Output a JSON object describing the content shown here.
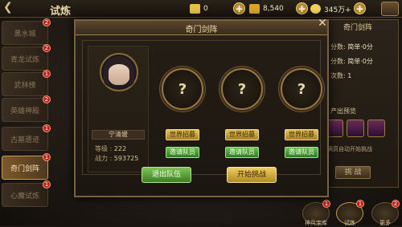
{
  "header": {
    "title": "试炼",
    "back_icon": "back-arrow-icon"
  },
  "resources": [
    {
      "name": "元宝",
      "value": "0",
      "color": "#e6c04a"
    },
    {
      "name": "金币",
      "value": "8,540",
      "color": "#d9a52a"
    },
    {
      "name": "体力",
      "value": "345万+",
      "color": "#f0d060"
    }
  ],
  "sidebar": {
    "items": [
      {
        "label": "黑水城",
        "badge": "2"
      },
      {
        "label": "青龙试炼",
        "badge": "2"
      },
      {
        "label": "武林榜",
        "badge": "1"
      },
      {
        "label": "英雄神殿",
        "badge": "2"
      },
      {
        "label": "古墓遗迹",
        "badge": "1"
      },
      {
        "label": "奇门剑阵",
        "badge": "1"
      },
      {
        "label": "心魔试炼",
        "badge": "1"
      }
    ],
    "active_index": 5
  },
  "right_panel": {
    "title": "奇门剑阵",
    "lines": [
      {
        "label": "分数:",
        "value": "简单·0分"
      },
      {
        "label": "分数:",
        "value": "简单·0分"
      },
      {
        "label": "次数:",
        "value": "1"
      }
    ],
    "drop_title": "产出预览",
    "auto_text": "满员自动开始挑战",
    "challenge_label": "挑 战"
  },
  "modal": {
    "title": "奇门剑阵",
    "leader": {
      "name": "宁清媛",
      "level_label": "等级 :",
      "level": "222",
      "power_label": "战力 :",
      "power": "593725"
    },
    "slots": [
      {
        "placeholder": "?",
        "recruit": "世界招募",
        "invite": "邀请队员"
      },
      {
        "placeholder": "?",
        "recruit": "世界招募",
        "invite": "邀请队员"
      },
      {
        "placeholder": "?",
        "recruit": "世界招募",
        "invite": "邀请队员"
      }
    ],
    "leave_label": "退出队伍",
    "start_label": "开始挑战"
  },
  "bottom_nav": [
    {
      "label": "神兵宝库",
      "badge": "1"
    },
    {
      "label": "试炼",
      "badge": "1"
    },
    {
      "label": "更多",
      "badge": "2"
    }
  ]
}
